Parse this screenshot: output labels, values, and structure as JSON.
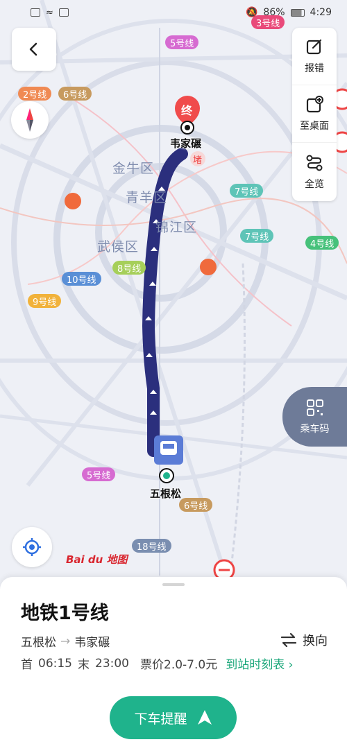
{
  "status_bar": {
    "battery": "86%",
    "time": "4:29"
  },
  "map": {
    "districts": [
      "金牛区",
      "青羊区",
      "锦江区",
      "武侯区"
    ],
    "line_tags": [
      {
        "label": "3号线",
        "color": "#e94a7a"
      },
      {
        "label": "5号线",
        "color": "#d66bd1"
      },
      {
        "label": "2号线",
        "color": "#f08a53"
      },
      {
        "label": "6号线",
        "color": "#c79a5e"
      },
      {
        "label": "7号线",
        "color": "#5ec4b7"
      },
      {
        "label": "7号线",
        "color": "#5ec4b7"
      },
      {
        "label": "4号线",
        "color": "#46c17a"
      },
      {
        "label": "8号线",
        "color": "#a6cf5a"
      },
      {
        "label": "10号线",
        "color": "#5a8fd6"
      },
      {
        "label": "9号线",
        "color": "#f1b23b"
      },
      {
        "label": "5号线",
        "color": "#d66bd1"
      },
      {
        "label": "6号线",
        "color": "#c79a5e"
      },
      {
        "label": "18号线",
        "color": "#7a8eb0"
      }
    ],
    "end_marker": "终",
    "end_station": "韦家碾",
    "start_station": "五根松",
    "congestion_label": "堵",
    "baidu_logo": "Bai du 地图"
  },
  "toolbar": {
    "report": "报错",
    "desktop": "至桌面",
    "overview": "全览",
    "ride_code": "乘车码"
  },
  "sheet": {
    "title": "地铁1号线",
    "from": "五根松",
    "arrow": "→",
    "to": "韦家碾",
    "switch_label": "换向",
    "first_label": "首",
    "first_time": "06:15",
    "last_label": "末",
    "last_time": "23:00",
    "fare": "票价2.0-7.0元",
    "timetable_link": "到站时刻表",
    "alert_button": "下车提醒"
  }
}
